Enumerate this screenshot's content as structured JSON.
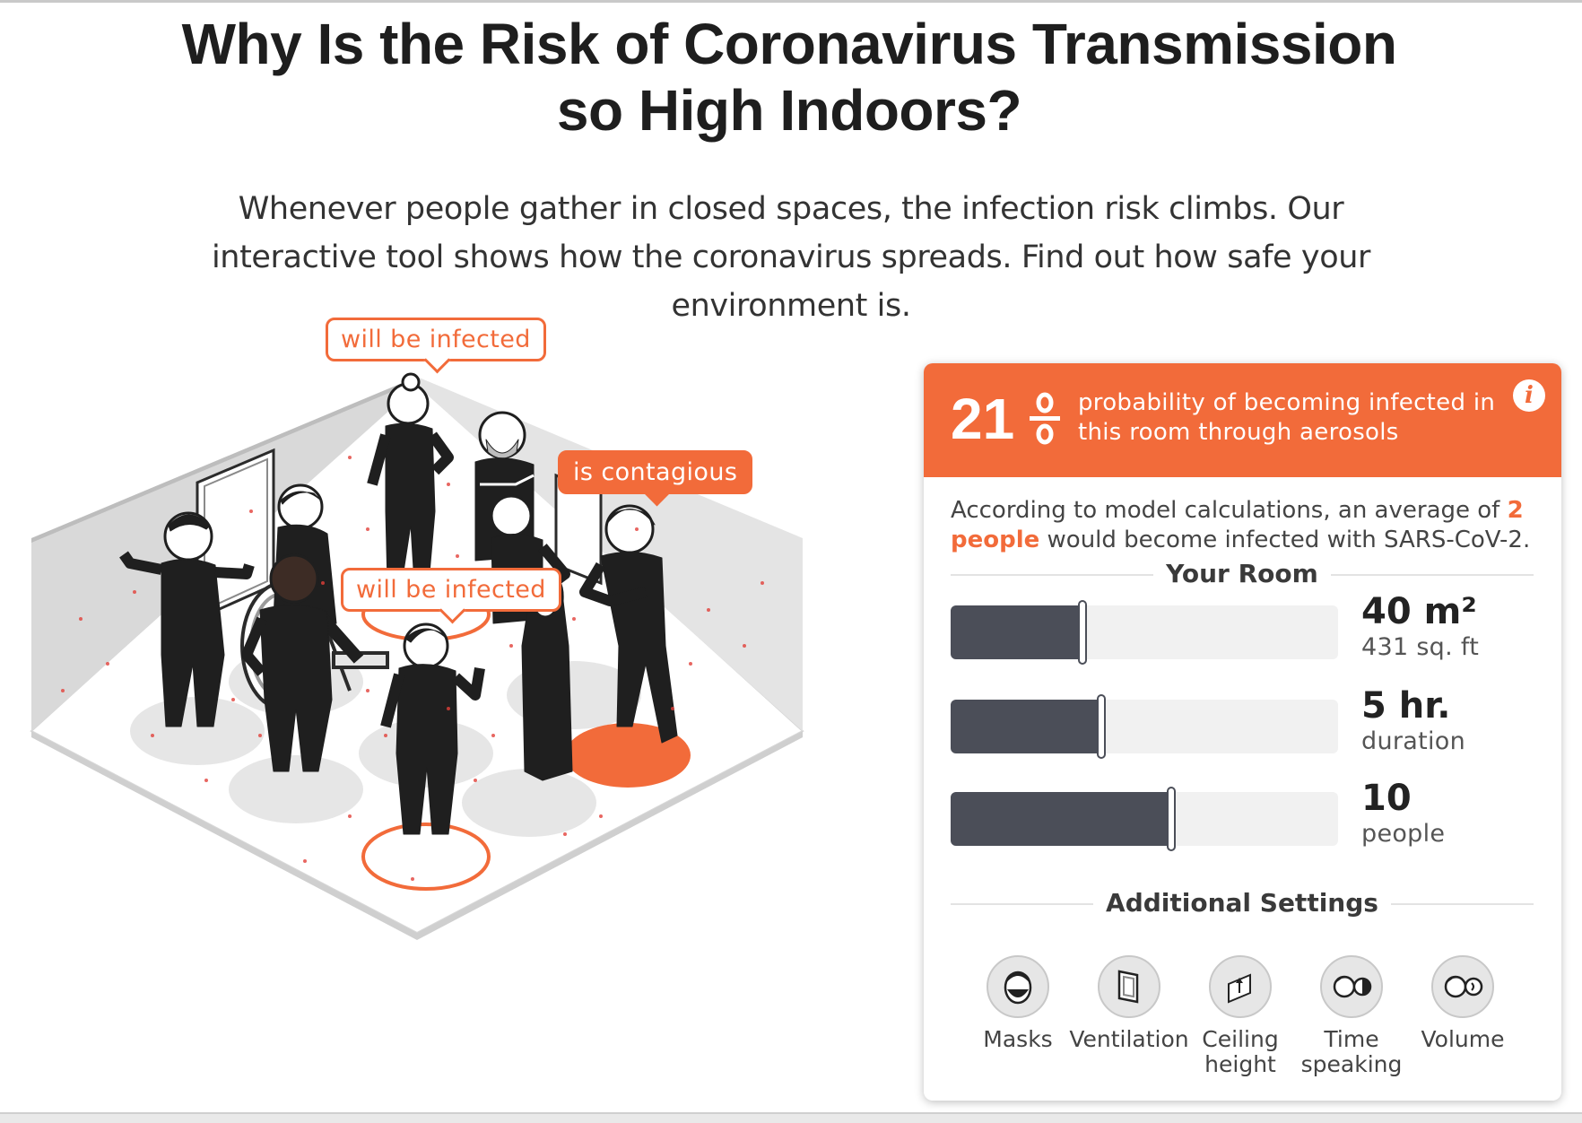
{
  "header": {
    "title": "Why Is the Risk of Coronavirus Transmission so High Indoors?",
    "intro": "Whenever people gather in closed spaces, the infection risk climbs. Our interactive tool shows how the coronavirus spreads. Find out how safe your environment is."
  },
  "scene": {
    "bubbles": {
      "top": "will be infected",
      "contagious": "is contagious",
      "middle": "will be infected"
    }
  },
  "panel": {
    "probability": {
      "value": "21",
      "text": "probability of becoming infected in this room through aerosols",
      "info_icon": "info-icon"
    },
    "summary": {
      "prefix": "According to model calculations, an average of ",
      "highlight": "2 people",
      "suffix": " would become infected with SARS-CoV-2."
    },
    "your_room": {
      "heading": "Your Room",
      "sliders": [
        {
          "name": "room-size",
          "value_big": "40 m²",
          "value_small": "431 sq. ft",
          "fraction": 0.34
        },
        {
          "name": "duration",
          "value_big": "5 hr.",
          "value_small": "duration",
          "fraction": 0.39
        },
        {
          "name": "people",
          "value_big": "10",
          "value_small": "people",
          "fraction": 0.57
        }
      ]
    },
    "additional_settings": {
      "heading": "Additional Settings",
      "items": [
        {
          "label": "Masks",
          "icon": "mask-face-icon"
        },
        {
          "label": "Ventilation",
          "icon": "window-icon"
        },
        {
          "label": "Ceiling height",
          "icon": "ceiling-height-icon"
        },
        {
          "label": "Time speaking",
          "icon": "time-speaking-icon"
        },
        {
          "label": "Volume",
          "icon": "volume-icon"
        }
      ]
    }
  },
  "colors": {
    "accent": "#f26b3a",
    "slider_fill": "#4b4e58",
    "figure": "#1f1f1f"
  }
}
